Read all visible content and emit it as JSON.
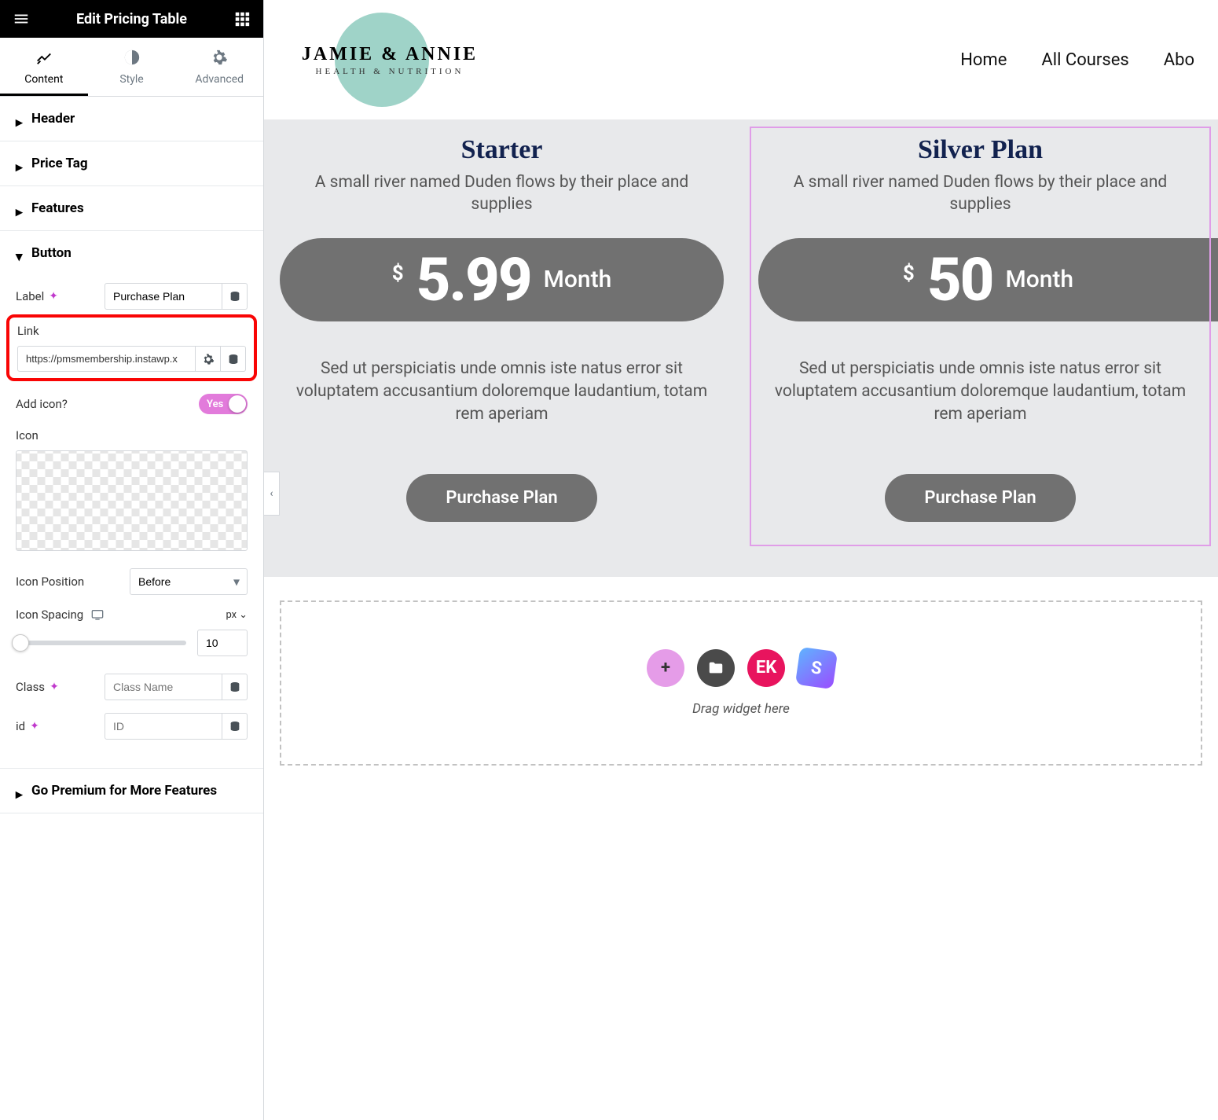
{
  "sidebar": {
    "title": "Edit Pricing Table",
    "tabs": [
      {
        "label": "Content",
        "active": true
      },
      {
        "label": "Style",
        "active": false
      },
      {
        "label": "Advanced",
        "active": false
      }
    ],
    "sections": {
      "header": "Header",
      "price_tag": "Price Tag",
      "features": "Features",
      "button": "Button",
      "premium": "Go Premium for More Features"
    },
    "button": {
      "label_field": "Label",
      "label_value": "Purchase Plan",
      "link_field": "Link",
      "link_value": "https://pmsmembership.instawp.x",
      "add_icon_field": "Add icon?",
      "add_icon_toggle": "Yes",
      "icon_field": "Icon",
      "icon_position_field": "Icon Position",
      "icon_position_value": "Before",
      "icon_spacing_field": "Icon Spacing",
      "icon_spacing_unit": "px",
      "icon_spacing_value": "10",
      "class_field": "Class",
      "class_placeholder": "Class Name",
      "id_field": "id",
      "id_placeholder": "ID"
    }
  },
  "preview": {
    "logo": {
      "name": "JAMIE & ANNIE",
      "tag": "HEALTH & NUTRITION"
    },
    "nav": [
      "Home",
      "All Courses",
      "Abo"
    ],
    "cards": [
      {
        "title": "Starter",
        "sub": "A small river named Duden flows by their place and supplies",
        "cur": "$",
        "price": "5.99",
        "period": "Month",
        "body": "Sed ut perspiciatis unde omnis iste natus error sit voluptatem accusantium doloremque laudantium, totam rem aperiam",
        "btn": "Purchase Plan"
      },
      {
        "title": "Silver Plan",
        "sub": "A small river named Duden flows by their place and supplies",
        "cur": "$",
        "price": "50",
        "period": "Month",
        "body": "Sed ut perspiciatis unde omnis iste natus error sit voluptatem accusantium doloremque laudantium, totam rem aperiam",
        "btn": "Purchase Plan"
      }
    ],
    "dropzone_text": "Drag widget here"
  }
}
